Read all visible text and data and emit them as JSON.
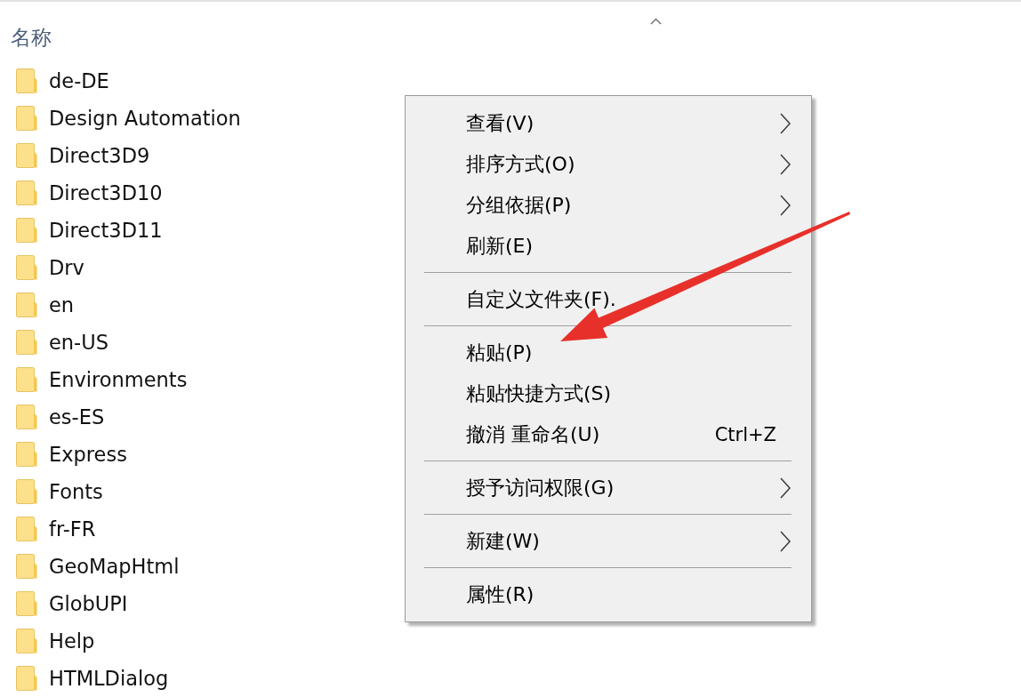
{
  "column_header": {
    "label": "名称",
    "sorted": true
  },
  "folders": [
    {
      "name": "de-DE"
    },
    {
      "name": "Design Automation"
    },
    {
      "name": "Direct3D9"
    },
    {
      "name": "Direct3D10"
    },
    {
      "name": "Direct3D11"
    },
    {
      "name": "Drv"
    },
    {
      "name": "en"
    },
    {
      "name": "en-US"
    },
    {
      "name": "Environments"
    },
    {
      "name": "es-ES"
    },
    {
      "name": "Express"
    },
    {
      "name": "Fonts"
    },
    {
      "name": "fr-FR"
    },
    {
      "name": "GeoMapHtml"
    },
    {
      "name": "GlobUPI"
    },
    {
      "name": "Help"
    },
    {
      "name": "HTMLDialog"
    }
  ],
  "context_menu": {
    "items": [
      {
        "kind": "item",
        "label": "查看(V)",
        "submenu": true
      },
      {
        "kind": "item",
        "label": "排序方式(O)",
        "submenu": true
      },
      {
        "kind": "item",
        "label": "分组依据(P)",
        "submenu": true
      },
      {
        "kind": "item",
        "label": "刷新(E)",
        "submenu": false
      },
      {
        "kind": "separator"
      },
      {
        "kind": "item",
        "label": "自定义文件夹(F).",
        "submenu": false
      },
      {
        "kind": "separator"
      },
      {
        "kind": "item",
        "label": "粘贴(P)",
        "submenu": false
      },
      {
        "kind": "item",
        "label": "粘贴快捷方式(S)",
        "submenu": false
      },
      {
        "kind": "item",
        "label": "撤消 重命名(U)",
        "shortcut": "Ctrl+Z",
        "submenu": false
      },
      {
        "kind": "separator"
      },
      {
        "kind": "item",
        "label": "授予访问权限(G)",
        "submenu": true
      },
      {
        "kind": "separator"
      },
      {
        "kind": "item",
        "label": "新建(W)",
        "submenu": true
      },
      {
        "kind": "separator"
      },
      {
        "kind": "item",
        "label": "属性(R)",
        "submenu": false
      }
    ]
  },
  "annotation": {
    "kind": "arrow"
  }
}
